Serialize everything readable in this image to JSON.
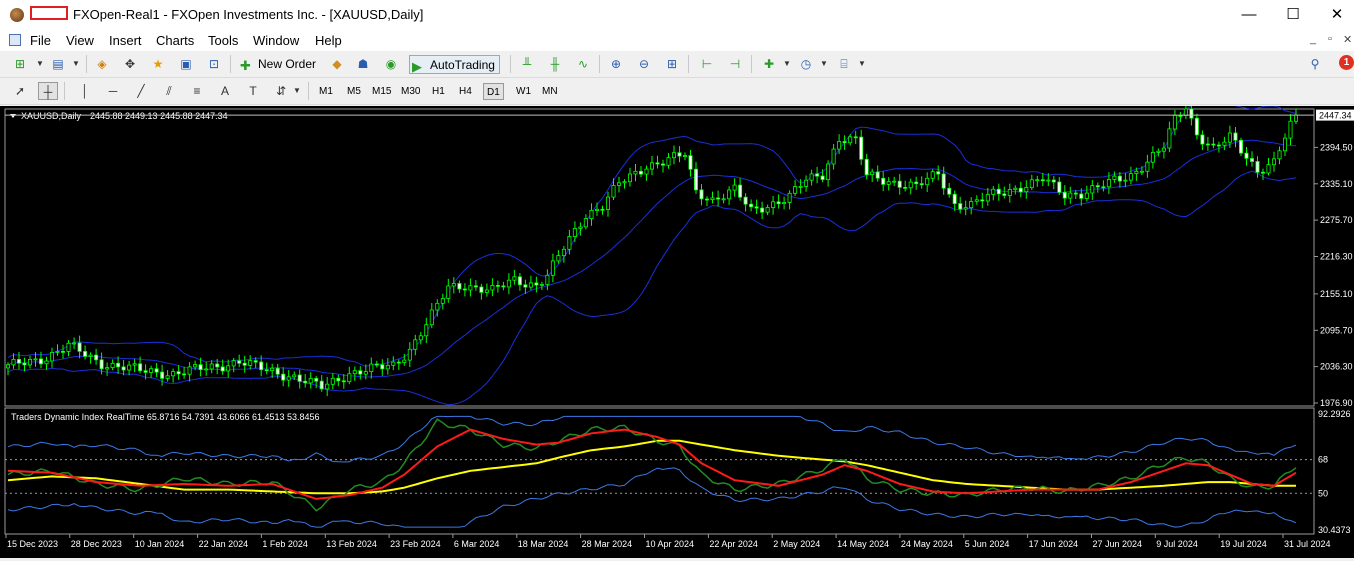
{
  "window": {
    "title": "FXOpen-Real1 - FXOpen Investments Inc. - [XAUUSD,Daily]",
    "minimize": "—",
    "maximize": "☐",
    "close": "✕"
  },
  "menu": {
    "items": [
      "File",
      "View",
      "Insert",
      "Charts",
      "Tools",
      "Window",
      "Help"
    ],
    "controls": [
      "_",
      "▫",
      "✕"
    ]
  },
  "toolbar": {
    "new_order": "New Order",
    "auto_trading": "AutoTrading",
    "notification_count": "1"
  },
  "periods": [
    "M1",
    "M5",
    "M15",
    "M30",
    "H1",
    "H4",
    "D1",
    "W1",
    "MN"
  ],
  "active_period": "D1",
  "main_chart": {
    "symbol_label": "XAUUSD,Daily",
    "ohlc_text": "2445.88 2449.13 2445.88 2447.34",
    "current_price": "2447.34",
    "price_ticks": [
      "2394.50",
      "2335.10",
      "2275.70",
      "2216.30",
      "2155.10",
      "2095.70",
      "2036.30",
      "1976.90"
    ],
    "colors": {
      "bull": "#00ff00",
      "bear": "#ffffff",
      "band": "#1a2fd8",
      "grid_line": "#c0c0c0"
    }
  },
  "indicator": {
    "label": "Traders Dynamic Index RealTime 65.8716 54.7391 43.6066 61.4513 53.8456",
    "ticks": [
      "92.2926",
      "68",
      "50",
      "30.4373"
    ],
    "colors": {
      "band": "#3c78e6",
      "rsi": "#228b22",
      "signal": "#ff1a1a",
      "base": "#ffff00"
    }
  },
  "date_axis": [
    "15 Dec 2023",
    "28 Dec 2023",
    "10 Jan 2024",
    "22 Jan 2024",
    "1 Feb 2024",
    "13 Feb 2024",
    "23 Feb 2024",
    "6 Mar 2024",
    "18 Mar 2024",
    "28 Mar 2024",
    "10 Apr 2024",
    "22 Apr 2024",
    "2 May 2024",
    "14 May 2024",
    "24 May 2024",
    "5 Jun 2024",
    "17 Jun 2024",
    "27 Jun 2024",
    "9 Jul 2024",
    "19 Jul 2024",
    "31 Jul 2024"
  ],
  "chart_data": {
    "type": "candlestick",
    "symbol": "XAUUSD",
    "timeframe": "Daily",
    "x_range": [
      "15 Dec 2023",
      "31 Jul 2024"
    ],
    "y_range": [
      1976.9,
      2454.0
    ],
    "anchors": [
      [
        0,
        2036
      ],
      [
        7,
        2052
      ],
      [
        11,
        2070
      ],
      [
        17,
        2042
      ],
      [
        24,
        2030
      ],
      [
        30,
        2025
      ],
      [
        38,
        2037
      ],
      [
        42,
        2045
      ],
      [
        47,
        2030
      ],
      [
        52,
        2020
      ],
      [
        57,
        2002
      ],
      [
        62,
        2026
      ],
      [
        70,
        2038
      ],
      [
        73,
        2065
      ],
      [
        77,
        2120
      ],
      [
        80,
        2165
      ],
      [
        83,
        2170
      ],
      [
        88,
        2160
      ],
      [
        92,
        2178
      ],
      [
        96,
        2170
      ],
      [
        98,
        2185
      ],
      [
        101,
        2230
      ],
      [
        105,
        2285
      ],
      [
        108,
        2300
      ],
      [
        111,
        2335
      ],
      [
        113,
        2345
      ],
      [
        116,
        2365
      ],
      [
        120,
        2375
      ],
      [
        123,
        2382
      ],
      [
        125,
        2322
      ],
      [
        128,
        2310
      ],
      [
        132,
        2325
      ],
      [
        135,
        2290
      ],
      [
        138,
        2300
      ],
      [
        142,
        2315
      ],
      [
        145,
        2340
      ],
      [
        148,
        2350
      ],
      [
        151,
        2410
      ],
      [
        154,
        2405
      ],
      [
        156,
        2348
      ],
      [
        160,
        2340
      ],
      [
        165,
        2330
      ],
      [
        169,
        2352
      ],
      [
        172,
        2302
      ],
      [
        175,
        2300
      ],
      [
        179,
        2318
      ],
      [
        183,
        2328
      ],
      [
        186,
        2335
      ],
      [
        188,
        2342
      ],
      [
        192,
        2318
      ],
      [
        195,
        2320
      ],
      [
        198,
        2328
      ],
      [
        201,
        2340
      ],
      [
        204,
        2350
      ],
      [
        207,
        2372
      ],
      [
        210,
        2395
      ],
      [
        212,
        2440
      ],
      [
        214,
        2462
      ],
      [
        216,
        2418
      ],
      [
        219,
        2392
      ],
      [
        222,
        2410
      ],
      [
        225,
        2380
      ],
      [
        227,
        2358
      ],
      [
        230,
        2370
      ],
      [
        232,
        2410
      ],
      [
        234,
        2447
      ]
    ],
    "tdi_anchors": [
      [
        0,
        60,
        62,
        57
      ],
      [
        8,
        62,
        61,
        59
      ],
      [
        16,
        55,
        56,
        58
      ],
      [
        24,
        52,
        54,
        55
      ],
      [
        32,
        58,
        55,
        52
      ],
      [
        40,
        55,
        54,
        52
      ],
      [
        48,
        56,
        55,
        51
      ],
      [
        56,
        42,
        47,
        50
      ],
      [
        62,
        52,
        49,
        50
      ],
      [
        68,
        56,
        53,
        51
      ],
      [
        72,
        66,
        60,
        53
      ],
      [
        78,
        88,
        75,
        58
      ],
      [
        84,
        84,
        84,
        62
      ],
      [
        90,
        76,
        79,
        64
      ],
      [
        96,
        74,
        76,
        66
      ],
      [
        100,
        78,
        77,
        69
      ],
      [
        106,
        84,
        82,
        73
      ],
      [
        112,
        85,
        84,
        75
      ],
      [
        118,
        78,
        80,
        78
      ],
      [
        122,
        75,
        76,
        78
      ],
      [
        126,
        60,
        66,
        76
      ],
      [
        132,
        52,
        57,
        73
      ],
      [
        140,
        55,
        54,
        70
      ],
      [
        148,
        63,
        60,
        68
      ],
      [
        152,
        69,
        65,
        67
      ],
      [
        156,
        58,
        62,
        65
      ],
      [
        162,
        52,
        55,
        61
      ],
      [
        168,
        50,
        51,
        57
      ],
      [
        174,
        49,
        50,
        55
      ],
      [
        180,
        52,
        51,
        54
      ],
      [
        186,
        53,
        52,
        53
      ],
      [
        192,
        51,
        52,
        52
      ],
      [
        198,
        54,
        52,
        52
      ],
      [
        204,
        58,
        56,
        53
      ],
      [
        210,
        66,
        62,
        54
      ],
      [
        214,
        69,
        66,
        55
      ],
      [
        218,
        66,
        65,
        56
      ],
      [
        222,
        58,
        60,
        56
      ],
      [
        226,
        53,
        55,
        55
      ],
      [
        230,
        54,
        54,
        54
      ],
      [
        234,
        65,
        61,
        54
      ]
    ]
  }
}
